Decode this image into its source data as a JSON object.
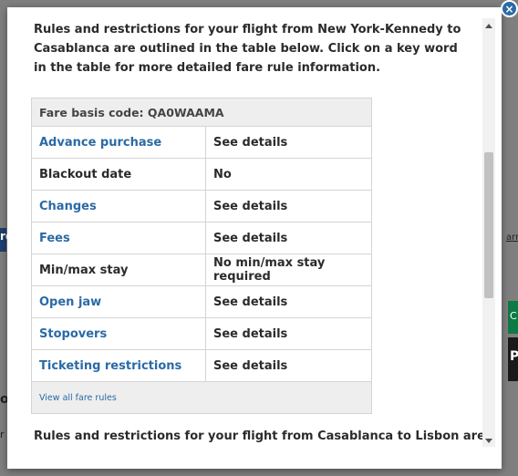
{
  "background": {
    "left_fragment_1": "re",
    "left_fragment_2": "or",
    "left_fragment_3": "r",
    "right_fragment_1": "arn",
    "right_fragment_2": "C",
    "right_fragment_3": "P"
  },
  "modal": {
    "intro_text": "Rules and restrictions for your flight from New York-Kennedy to Casablanca are outlined in the table below. Click on a key word in the table for more detailed fare rule information.",
    "fare_table": {
      "header": "Fare basis code: QA0WAAMA",
      "rows": [
        {
          "key": "Advance purchase",
          "value": "See details"
        },
        {
          "key": "Blackout date",
          "value": "No"
        },
        {
          "key": "Changes",
          "value": "See details"
        },
        {
          "key": "Fees",
          "value": "See details"
        },
        {
          "key": "Min/max stay",
          "value": "No min/max stay required"
        },
        {
          "key": "Open jaw",
          "value": "See details"
        },
        {
          "key": "Stopovers",
          "value": "See details"
        },
        {
          "key": "Ticketing restrictions",
          "value": "See details"
        }
      ],
      "footer_link": "View all fare rules"
    },
    "second_intro": "Rules and restrictions for your flight from Casablanca to Lisbon are",
    "close_label": "×"
  },
  "colors": {
    "link": "#2a6aa6",
    "overlay": "#7f7f7f"
  }
}
